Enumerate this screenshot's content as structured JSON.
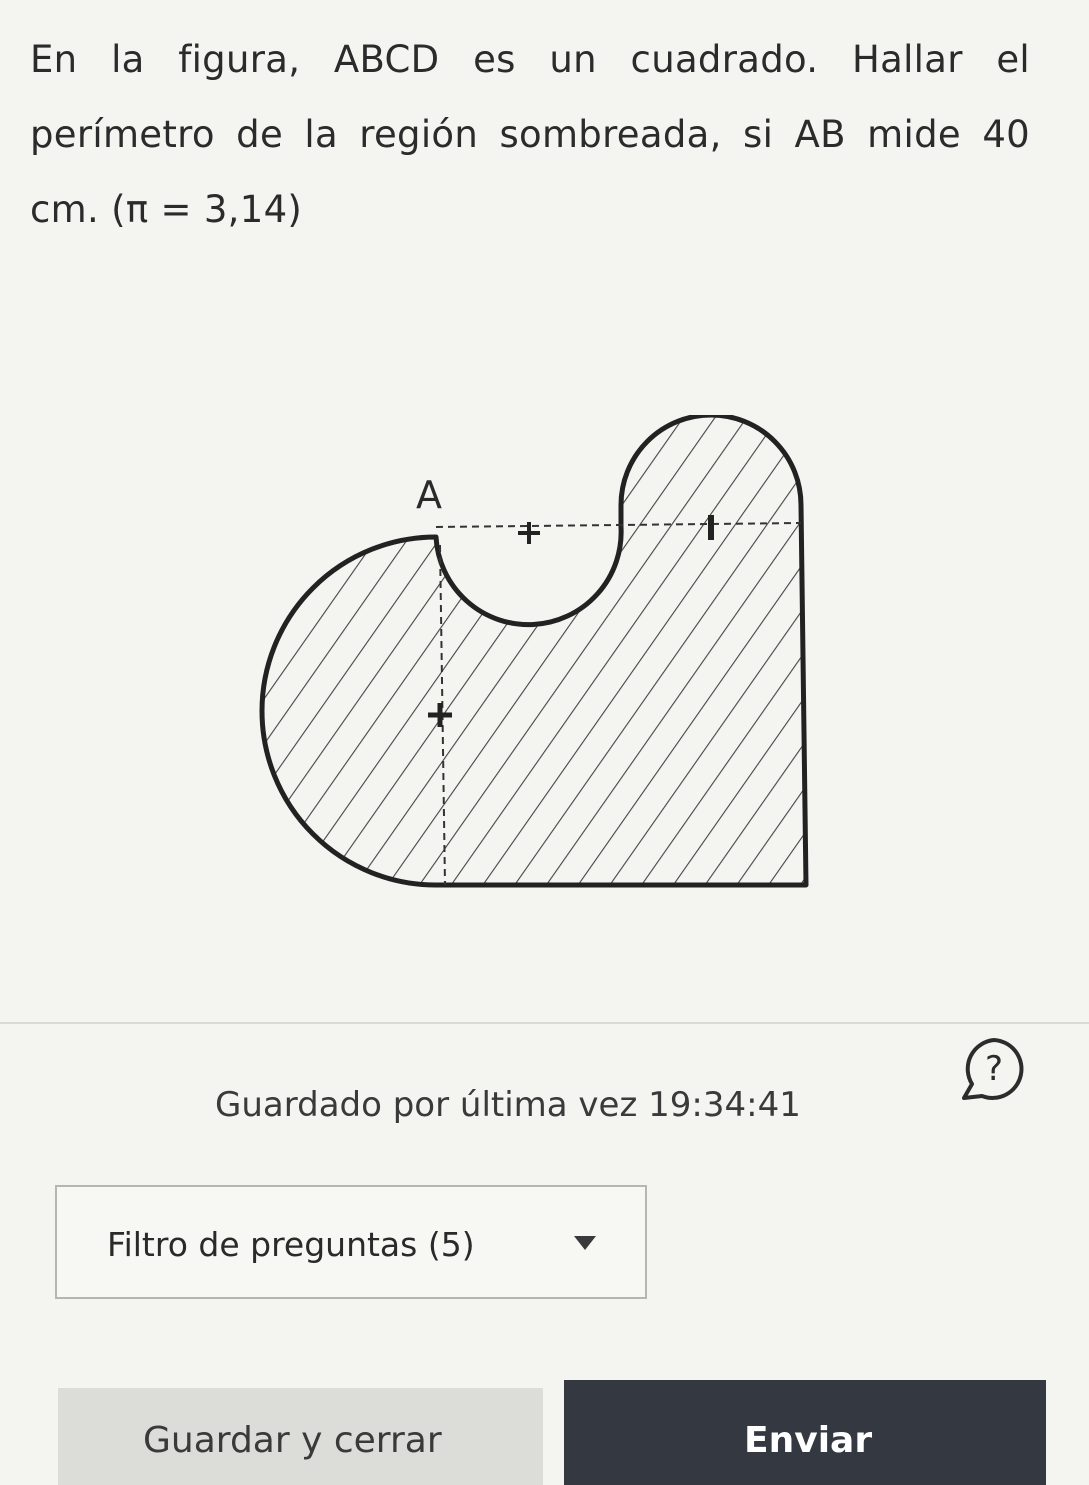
{
  "question": {
    "text": "En la figura, ABCD es un cuadrado. Hallar el perímetro de la región sombreada, si AB mide 40 cm. (π = 3,14)"
  },
  "figure": {
    "vertex_label": "A"
  },
  "status": {
    "saved_label": "Guardado por última vez",
    "saved_time": "19:34:41"
  },
  "filter": {
    "label": "Filtro de preguntas (5)"
  },
  "buttons": {
    "save_close": "Guardar y cerrar",
    "submit": "Enviar"
  },
  "help": {
    "icon": "question-bubble-icon"
  }
}
